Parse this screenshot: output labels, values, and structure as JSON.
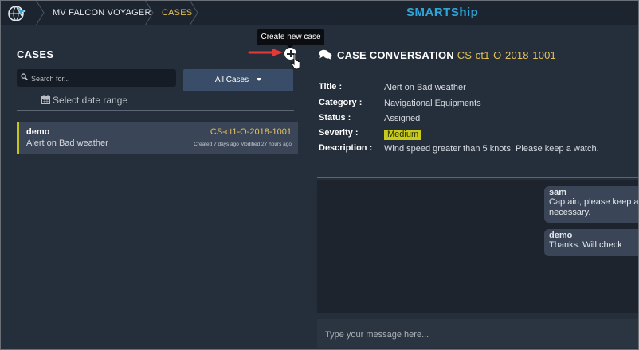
{
  "header": {
    "vessel": "MV FALCON VOYAGER",
    "section": "CASES",
    "brand": "SMARTShip",
    "icons": {
      "logo": "globe-cursor-icon",
      "separator": "chevron-right-icon"
    }
  },
  "cases_panel": {
    "title": "CASES",
    "tooltip": "Create new case",
    "search_placeholder": "Search for...",
    "filter_selected": "All Cases",
    "date_range_label": "Select date range",
    "items": [
      {
        "name": "demo",
        "case_id": "CS-ct1-O-2018-1001",
        "subject": "Alert on Bad weather",
        "meta": "Created 7 days ago  Modified 27 hours ago"
      }
    ]
  },
  "conversation": {
    "title": "CASE CONVERSATION",
    "case_id": "CS-ct1-O-2018-1001",
    "fields": {
      "title_label": "Title :",
      "title_value": "Alert on Bad weather",
      "category_label": "Category :",
      "category_value": "Navigational Equipments",
      "status_label": "Status :",
      "status_value": "Assigned",
      "severity_label": "Severity :",
      "severity_value": "Medium",
      "description_label": "Description :",
      "description_value": "Wind speed greater than 5 knots. Please keep a watch."
    },
    "messages": [
      {
        "author": "sam",
        "line1": "Captain, please keep a c",
        "line2": "necessary."
      },
      {
        "author": "demo",
        "line1": "Thanks. Will check"
      }
    ],
    "input_placeholder": "Type your message here..."
  },
  "colors": {
    "background": "#252e3b",
    "topbar": "#1c2430",
    "accent_gold": "#e4c158",
    "brand_blue": "#2ea6d9",
    "severity_medium": "#c9ca1c",
    "filter_button": "#3a4d68"
  }
}
